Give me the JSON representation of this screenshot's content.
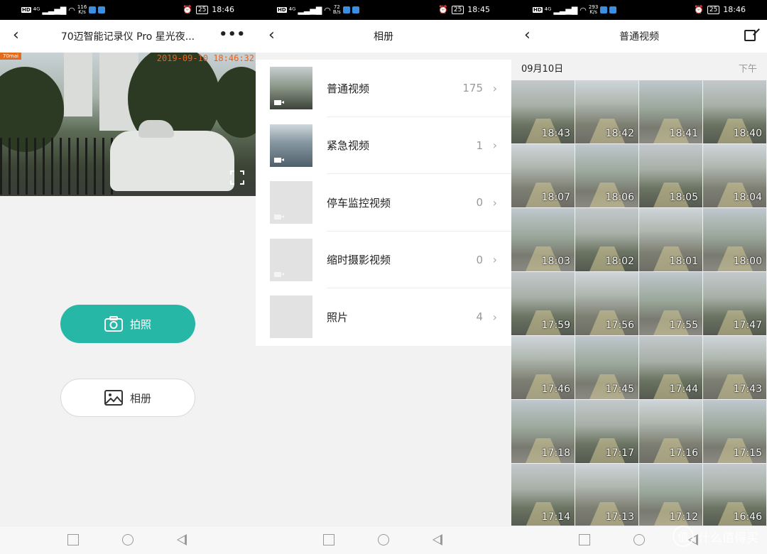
{
  "status_bars": [
    {
      "net_speed": "116\nK/s",
      "battery": "25",
      "time": "18:46"
    },
    {
      "net_speed": "72\nB/s",
      "battery": "25",
      "time": "18:45"
    },
    {
      "net_speed": "293\nK/s",
      "battery": "25",
      "time": "18:46"
    }
  ],
  "camera": {
    "title": "70迈智能记录仪 Pro 星光夜...",
    "back_icon": "chevron-left-icon",
    "more_icon": "more-icon",
    "logo_text": "70mai",
    "timestamp": "2019-09-10 18:46:32",
    "photo_button": "拍照",
    "album_button": "相册"
  },
  "album": {
    "title": "相册",
    "items": [
      {
        "label": "普通视频",
        "count": "175"
      },
      {
        "label": "紧急视频",
        "count": "1"
      },
      {
        "label": "停车监控视频",
        "count": "0"
      },
      {
        "label": "缩时摄影视频",
        "count": "0"
      },
      {
        "label": "照片",
        "count": "4"
      }
    ]
  },
  "videos": {
    "title": "普通视频",
    "date": "09月10日",
    "period": "下午",
    "times": [
      "18:43",
      "18:42",
      "18:41",
      "18:40",
      "18:07",
      "18:06",
      "18:05",
      "18:04",
      "18:03",
      "18:02",
      "18:01",
      "18:00",
      "17:59",
      "17:56",
      "17:55",
      "17:47",
      "17:46",
      "17:45",
      "17:44",
      "17:43",
      "17:18",
      "17:17",
      "17:16",
      "17:15",
      "17:14",
      "17:13",
      "17:12",
      "16:46"
    ]
  },
  "watermark": {
    "symbol": "值",
    "text": "什么值得买"
  },
  "colors": {
    "accent": "#27b7a7",
    "timestamp_orange": "#e8611c"
  }
}
